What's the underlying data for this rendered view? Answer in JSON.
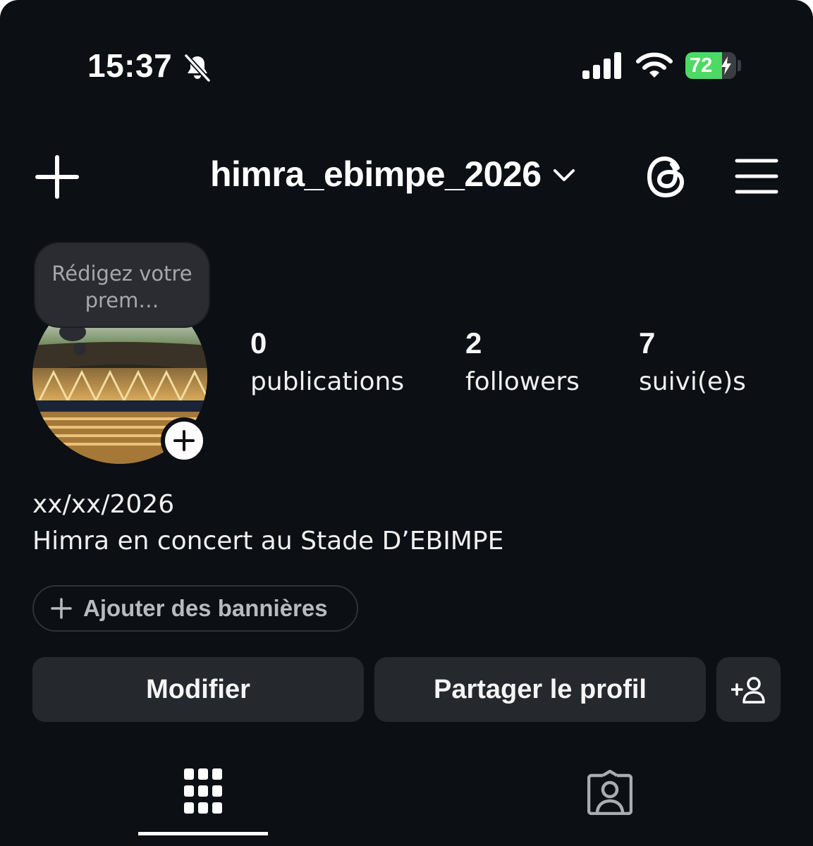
{
  "status_bar": {
    "time": "15:37",
    "battery_level": 72,
    "battery_text": "72",
    "icons": [
      "bell-slash-icon",
      "cellular-signal-icon",
      "wifi-icon",
      "battery-charging-icon"
    ]
  },
  "header": {
    "username": "himra_ebimpe_2026",
    "icons": [
      "plus-icon",
      "chevron-down-icon",
      "threads-icon",
      "hamburger-menu-icon"
    ]
  },
  "profile": {
    "note_text": "Rédigez votre prem…",
    "stats": [
      {
        "value": "0",
        "label": "publications"
      },
      {
        "value": "2",
        "label": "followers"
      },
      {
        "value": "7",
        "label": "suivi(e)s"
      }
    ],
    "bio_line1": "xx/xx/2026",
    "bio_line2": "Himra en concert au Stade D’EBIMPE",
    "banner_button": "Ajouter des bannières"
  },
  "actions": {
    "edit": "Modifier",
    "share": "Partager le profil",
    "add_icon": "add-person-icon"
  },
  "tabs": [
    {
      "icon": "grid-icon",
      "active": true
    },
    {
      "icon": "tagged-person-icon",
      "active": false
    }
  ],
  "colors": {
    "background": "#0c0f14",
    "button": "#25282d",
    "battery_green": "#4cd964",
    "text": "#f5f5f5"
  }
}
